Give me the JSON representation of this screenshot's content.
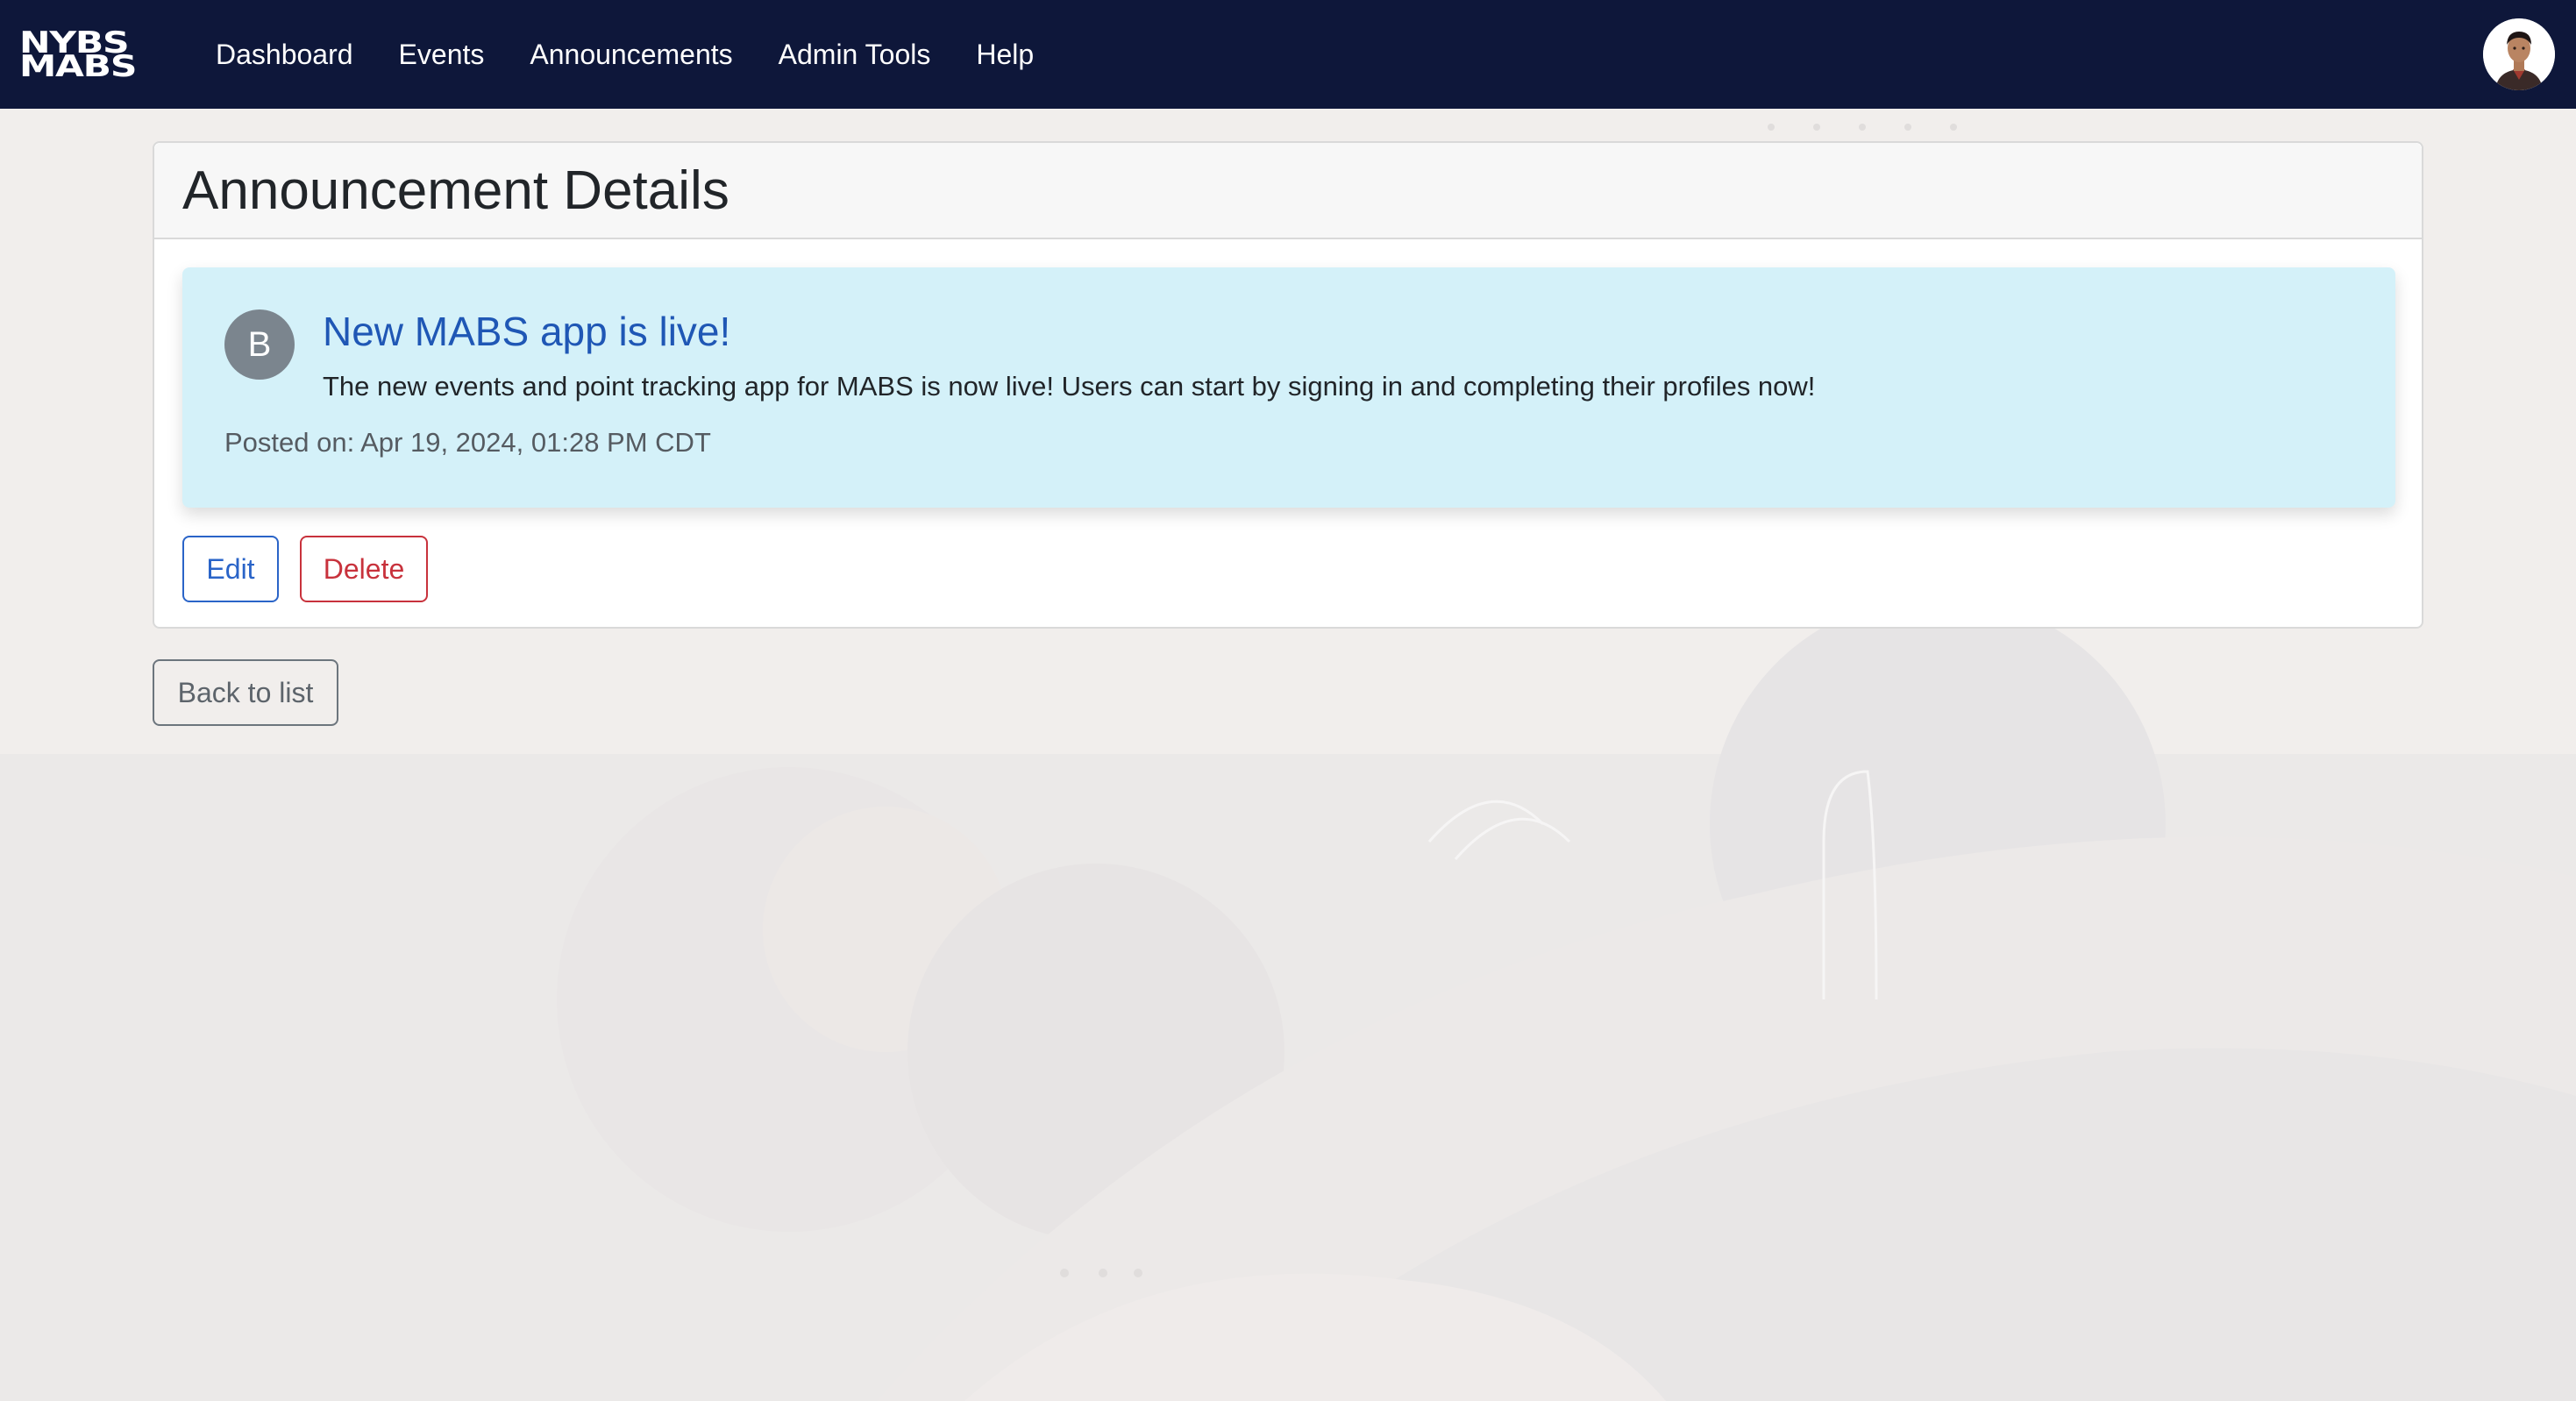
{
  "navbar": {
    "brand_line1": "NYBS",
    "brand_line2": "MABS",
    "links": [
      "Dashboard",
      "Events",
      "Announcements",
      "Admin Tools",
      "Help"
    ]
  },
  "card": {
    "title": "Announcement Details"
  },
  "announcement": {
    "author_initial": "B",
    "title": "New MABS app is live!",
    "body": "The new events and point tracking app for MABS is now live! Users can start by signing in and completing their profiles now!",
    "posted_on": "Posted on: Apr 19, 2024, 01:28 PM CDT"
  },
  "actions": {
    "edit_label": "Edit",
    "delete_label": "Delete",
    "back_label": "Back to list"
  },
  "colors": {
    "navbar_bg": "#0e173a",
    "announcement_bg": "#d4f1f9",
    "title_blue": "#1f57b5",
    "edit_blue": "#2a64c8",
    "delete_red": "#c8323c"
  }
}
